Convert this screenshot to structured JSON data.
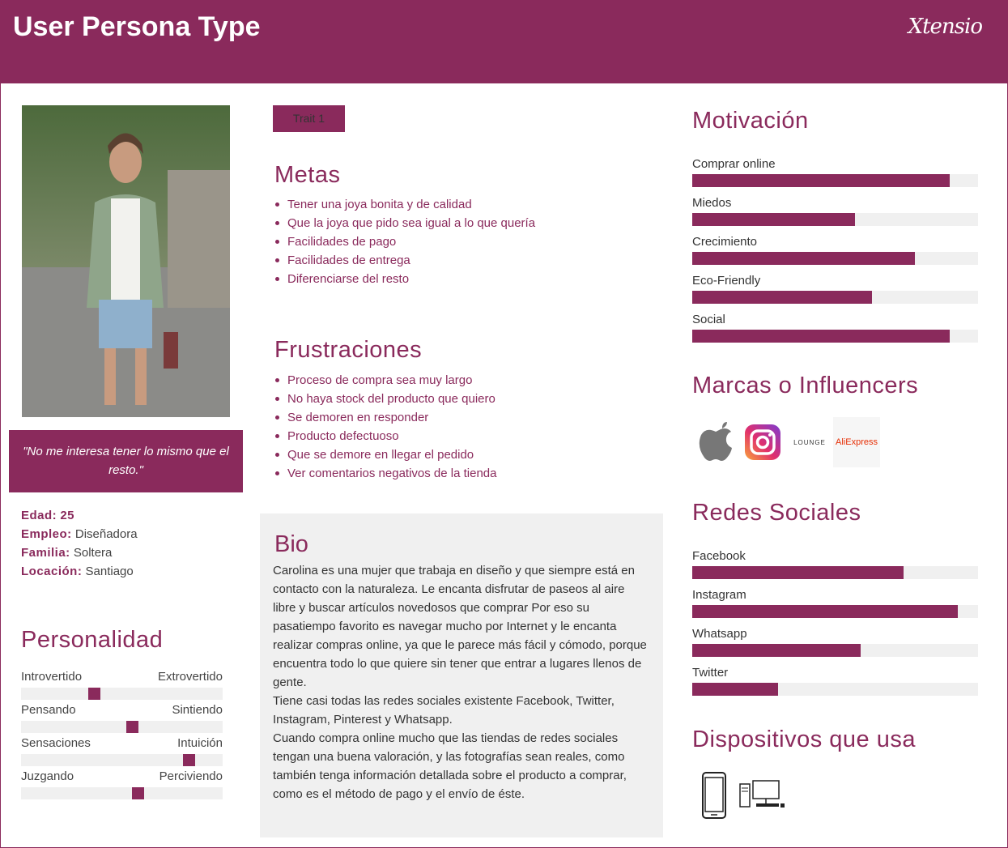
{
  "header": {
    "title": "User Persona Type",
    "brand": "Xtensio"
  },
  "quote": "\"No me interesa tener lo mismo que el resto.\"",
  "info": [
    {
      "key": "Edad:",
      "value": "25"
    },
    {
      "key": "Empleo:",
      "value": "Diseñadora"
    },
    {
      "key": "Familia:",
      "value": "Soltera"
    },
    {
      "key": "Locación:",
      "value": "Santiago"
    }
  ],
  "personality": {
    "title": "Personalidad",
    "scales": [
      {
        "left": "Introvertido",
        "right": "Extrovertido",
        "level": 0.36
      },
      {
        "left": "Pensando",
        "right": "Sintiendo",
        "level": 0.55
      },
      {
        "left": "Sensaciones",
        "right": "Intuición",
        "level": 0.83
      },
      {
        "left": "Juzgando",
        "right": "Perciviendo",
        "level": 0.58
      }
    ]
  },
  "trait": "Trait 1",
  "goals": {
    "title": "Metas",
    "items": [
      "Tener una joya bonita y de calidad",
      "Que la joya que pido sea igual a lo que quería",
      "Facilidades de pago",
      "Facilidades de entrega",
      "Diferenciarse del resto"
    ]
  },
  "frustrations": {
    "title": "Frustraciones",
    "items": [
      "Proceso de compra sea muy largo",
      "No haya stock del producto que quiero",
      "Se demoren en responder",
      "Producto defectuoso",
      "Que se demore en llegar el pedido",
      "Ver comentarios negativos de la tienda"
    ]
  },
  "bio": {
    "title": "Bio",
    "text": "Carolina es una mujer que trabaja en diseño y que siempre está en contacto con la naturaleza. Le encanta disfrutar de paseos al aire libre y buscar artículos novedosos que comprar Por eso su pasatiempo favorito es navegar mucho por Internet y le encanta realizar compras online, ya que le parece más fácil y cómodo, porque encuentra todo lo que quiere sin tener que entrar a lugares llenos de gente.\nTiene casi todas las redes sociales existente Facebook, Twitter, Instagram, Pinterest y Whatsapp.\nCuando compra online mucho que las tiendas de redes sociales tengan una buena valoración, y las fotografías sean reales, como también tenga información detallada sobre el producto a comprar, como es el método de pago y el envío de éste."
  },
  "motivation": {
    "title": "Motivación",
    "items": [
      {
        "label": "Comprar online",
        "level": 0.9
      },
      {
        "label": "Miedos",
        "level": 0.57
      },
      {
        "label": "Crecimiento",
        "level": 0.78
      },
      {
        "label": "Eco-Friendly",
        "level": 0.63
      },
      {
        "label": "Social",
        "level": 0.9
      }
    ]
  },
  "brands": {
    "title": "Marcas o Influencers",
    "items": [
      {
        "icon": "apple-logo-icon"
      },
      {
        "icon": "instagram-logo-icon"
      },
      {
        "icon": "lounge-logo-icon",
        "text": "LOUNGE"
      },
      {
        "icon": "aliexpress-logo-icon",
        "text": "AliExpress"
      }
    ]
  },
  "social": {
    "title": "Redes Sociales",
    "items": [
      {
        "label": "Facebook",
        "level": 0.74
      },
      {
        "label": "Instagram",
        "level": 0.93
      },
      {
        "label": "Whatsapp",
        "level": 0.59
      },
      {
        "label": "Twitter",
        "level": 0.3
      }
    ]
  },
  "devices": {
    "title": "Dispositivos que usa",
    "items": [
      {
        "icon": "smartphone-icon"
      },
      {
        "icon": "desktop-computer-icon"
      }
    ]
  },
  "colors": {
    "accent": "#8a2a5c",
    "track": "#f0f0f0"
  }
}
